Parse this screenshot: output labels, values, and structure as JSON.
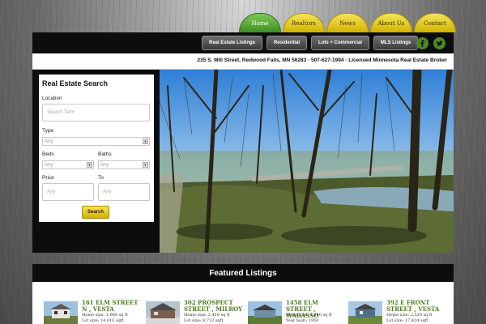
{
  "topnav": {
    "tabs": [
      {
        "label": "Home",
        "active": true
      },
      {
        "label": "Realtors",
        "active": false
      },
      {
        "label": "News",
        "active": false
      },
      {
        "label": "About Us",
        "active": false
      },
      {
        "label": "Contact",
        "active": false
      }
    ]
  },
  "subnav": {
    "items": [
      "Real Estate Listings",
      "Residential",
      "Lots + Commercial",
      "MLS Listings"
    ]
  },
  "social": [
    "facebook-icon",
    "twitter-icon"
  ],
  "address": "235 S. Mill Street, Redwood Falls, MN 56283 · 507-627-1994 · Licensed Minnesota Real Estate Broker",
  "search": {
    "title": "Real Estate Search",
    "location_label": "Location",
    "location_placeholder": "Search Term",
    "type_label": "Type",
    "type_value": "Any",
    "beds_label": "Beds",
    "beds_value": "Any",
    "baths_label": "Baths",
    "baths_value": "Any",
    "price_label": "Price",
    "to_label": "To",
    "price_from_placeholder": "Any",
    "price_to_placeholder": "Any",
    "button_label": "Search"
  },
  "featured": {
    "title": "Featured Listings",
    "listings": [
      {
        "title": "161 ELM STREET N , VESTA",
        "line1": "Home size: 1,668 sq ft",
        "line2": "Lot size: 14,810 sqft"
      },
      {
        "title": "302 PROSPECT STREET , MILROY",
        "line1": "Home size: 2,416 sq ft",
        "line2": "Lot size: 8,712 sqft"
      },
      {
        "title": "1458 ELM STREET , WABASSO",
        "line1": "Home size: 1,440 sq ft",
        "line2": "Year built: 1950"
      },
      {
        "title": "392 E FRONT STREET , VESTA",
        "line1": "Home size: 2,520 sq ft",
        "line2": "Lot size: 17,424 sqft"
      }
    ]
  },
  "colors": {
    "accent_green": "#4a7d1c",
    "tab_yellow": "#e8cf1f",
    "tab_active_green": "#5aa836",
    "header_black": "#0d0d0d"
  }
}
